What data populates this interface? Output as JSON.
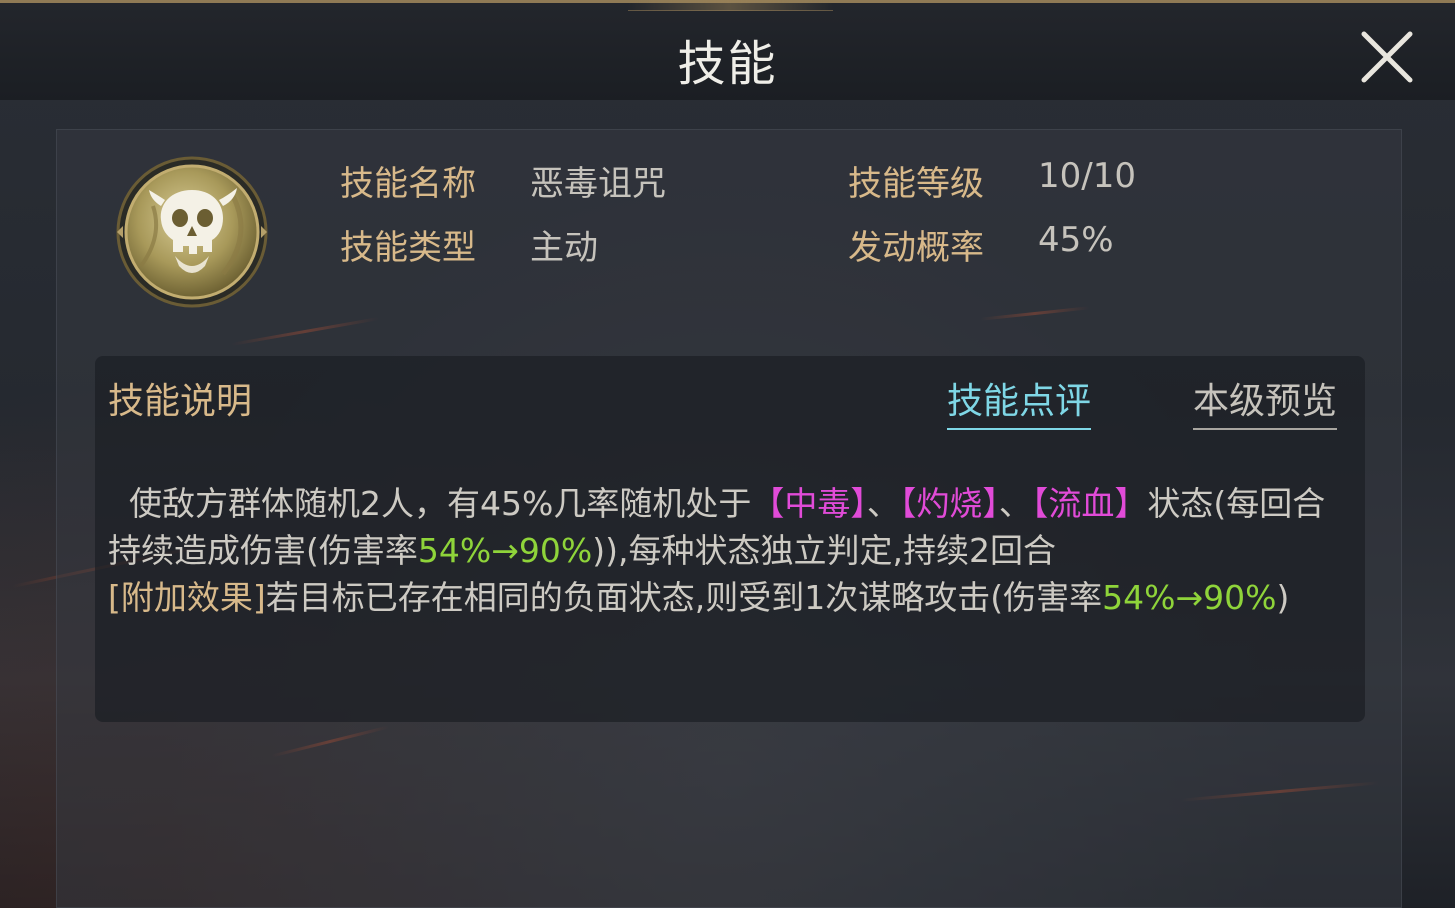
{
  "header": {
    "title": "技能"
  },
  "skill": {
    "icon": "skull-curse-icon",
    "name_label": "技能名称",
    "name_value": "恶毒诅咒",
    "type_label": "技能类型",
    "type_value": "主动",
    "level_label": "技能等级",
    "level_value": "10/10",
    "chance_label": "发动概率",
    "chance_value": "45%"
  },
  "description": {
    "title": "技能说明",
    "tabs": [
      {
        "label": "技能点评",
        "active": true
      },
      {
        "label": "本级预览",
        "active": false
      }
    ],
    "segments": [
      {
        "text": "使敌方群体随机2人，有45%几率随机处于",
        "style": "normal"
      },
      {
        "text": "【中毒】",
        "style": "magenta"
      },
      {
        "text": "、",
        "style": "normal"
      },
      {
        "text": "【灼烧】",
        "style": "magenta"
      },
      {
        "text": "、",
        "style": "normal"
      },
      {
        "text": "【流血】",
        "style": "magenta"
      },
      {
        "text": "状态(每回合持续造成伤害(伤害率",
        "style": "normal"
      },
      {
        "text": "54%→90%",
        "style": "green"
      },
      {
        "text": ")),每种状态独立判定,持续2回合\n",
        "style": "normal"
      },
      {
        "text": "[附加效果]",
        "style": "gold"
      },
      {
        "text": "若目标已存在相同的负面状态,则受到1次谋略攻击(伤害率",
        "style": "normal"
      },
      {
        "text": "54%→90%",
        "style": "green"
      },
      {
        "text": ")",
        "style": "normal"
      }
    ]
  },
  "colors": {
    "label_gold": "#d8b98a",
    "status_magenta": "#e14bd8",
    "value_green": "#8fd43a",
    "active_tab_cyan": "#7fd7e6"
  }
}
